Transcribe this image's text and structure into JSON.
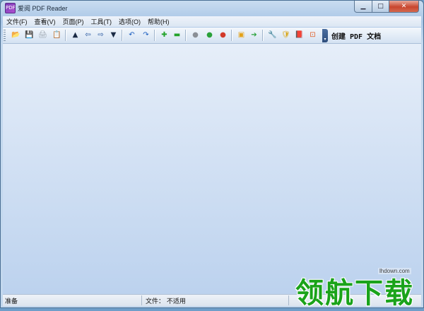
{
  "window": {
    "title": "爱阅 PDF Reader",
    "app_icon_text": "PDF",
    "min_glyph": "▁",
    "max_glyph": "□",
    "close_glyph": "✕"
  },
  "menu": [
    {
      "label": "文件(F)"
    },
    {
      "label": "查看(V)"
    },
    {
      "label": "页面(P)"
    },
    {
      "label": "工具(T)"
    },
    {
      "label": "选项(O)"
    },
    {
      "label": "帮助(H)"
    }
  ],
  "toolbar": {
    "icons": [
      {
        "name": "open-icon",
        "glyph": "📂",
        "color": "#d89a1e"
      },
      {
        "name": "save-icon",
        "glyph": "💾",
        "color": "#2d5fa8"
      },
      {
        "name": "print-icon",
        "glyph": "🖨",
        "color": "#9aa3ad"
      },
      {
        "name": "copy-icon",
        "glyph": "📋",
        "color": "#9aa3ad"
      },
      {
        "name": "first-page-icon",
        "glyph": "▲",
        "color": "#1a2a44"
      },
      {
        "name": "prev-page-icon",
        "glyph": "⇦",
        "color": "#1d4f9a"
      },
      {
        "name": "next-page-icon",
        "glyph": "⇨",
        "color": "#1d4f9a"
      },
      {
        "name": "last-page-icon",
        "glyph": "▼",
        "color": "#1a2a44"
      },
      {
        "name": "rotate-left-icon",
        "glyph": "↶",
        "color": "#1d5fc0"
      },
      {
        "name": "rotate-right-icon",
        "glyph": "↷",
        "color": "#1d5fc0"
      },
      {
        "name": "zoom-in-icon",
        "glyph": "✚",
        "color": "#23a32a"
      },
      {
        "name": "zoom-out-icon",
        "glyph": "▬",
        "color": "#23a32a"
      },
      {
        "name": "gray-circle-icon",
        "glyph": "●",
        "color": "#8a8f96"
      },
      {
        "name": "green-circle-icon",
        "glyph": "●",
        "color": "#2aa13a"
      },
      {
        "name": "red-circle-icon",
        "glyph": "●",
        "color": "#d23a2a"
      },
      {
        "name": "fit-page-icon",
        "glyph": "▣",
        "color": "#e3a21a"
      },
      {
        "name": "go-to-icon",
        "glyph": "➔",
        "color": "#2aa13a"
      },
      {
        "name": "tools-icon",
        "glyph": "🔧",
        "color": "#9aa3ad"
      },
      {
        "name": "security-icon",
        "glyph": "🛡",
        "color": "#d9a71a"
      },
      {
        "name": "bookmark-icon",
        "glyph": "📕",
        "color": "#b0306a"
      },
      {
        "name": "stop-icon",
        "glyph": "⊡",
        "color": "#e05a20"
      }
    ],
    "create_label": "创建 PDF 文档"
  },
  "status": {
    "left": "准备",
    "file": "文件： 不适用"
  },
  "watermark": {
    "url": "lhdown.com",
    "text": "领航下载"
  }
}
